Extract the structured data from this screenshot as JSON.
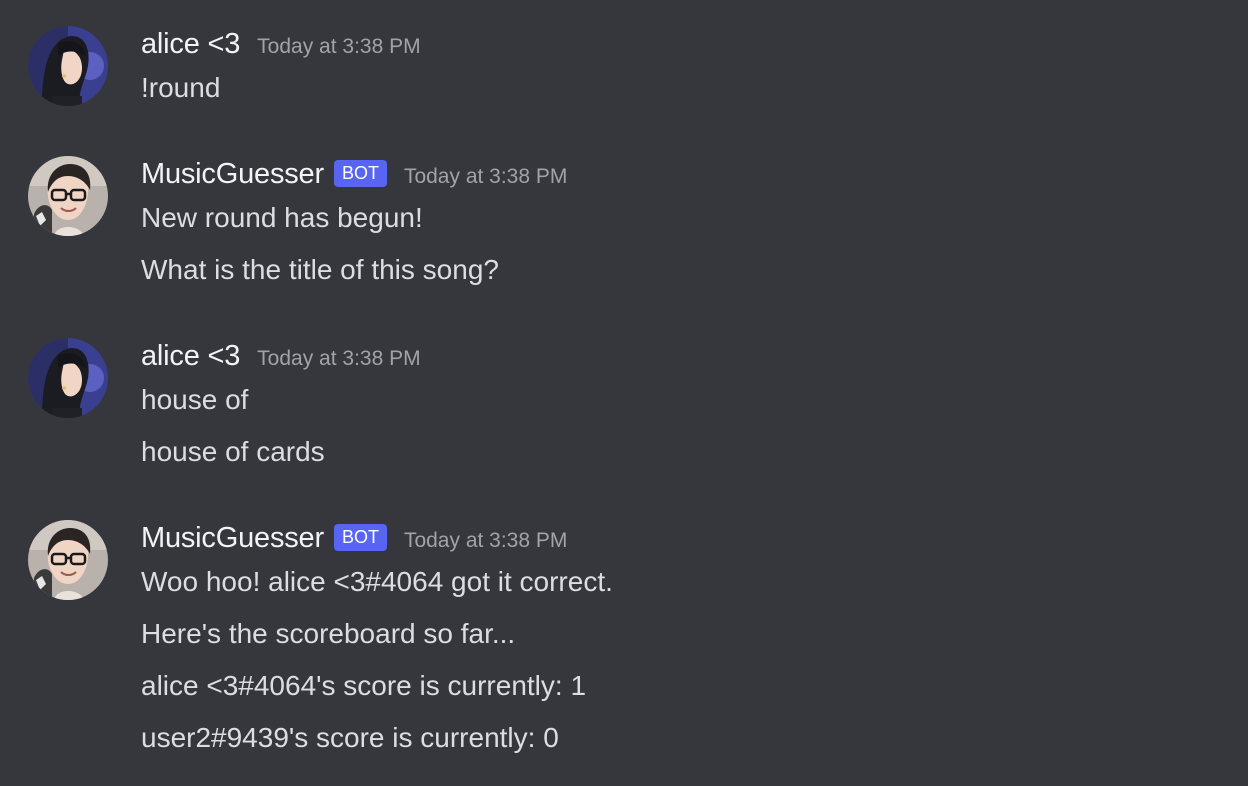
{
  "messages": [
    {
      "author": "alice <3",
      "timestamp": "Today at 3:38 PM",
      "avatar_icon": "anime-girl-avatar-icon",
      "lines": [
        "!round"
      ]
    },
    {
      "author": "MusicGuesser",
      "badge": "BOT",
      "timestamp": "Today at 3:38 PM",
      "avatar_icon": "person-glasses-avatar-icon",
      "lines": [
        "New round has begun!",
        "What is the title of this song?"
      ]
    },
    {
      "author": "alice <3",
      "timestamp": "Today at 3:38 PM",
      "avatar_icon": "anime-girl-avatar-icon",
      "lines": [
        "house of",
        "house of cards"
      ]
    },
    {
      "author": "MusicGuesser",
      "badge": "BOT",
      "timestamp": "Today at 3:38 PM",
      "avatar_icon": "person-glasses-avatar-icon",
      "lines": [
        "Woo hoo! alice <3#4064 got it correct.",
        "Here's the scoreboard so far...",
        "alice <3#4064's score is currently: 1",
        "user2#9439's score is currently: 0"
      ]
    }
  ],
  "colors": {
    "background": "#36373d",
    "text": "#dbdee1",
    "username": "#f2f3f5",
    "timestamp": "#a0a3aa",
    "bot_badge": "#5865f2"
  }
}
